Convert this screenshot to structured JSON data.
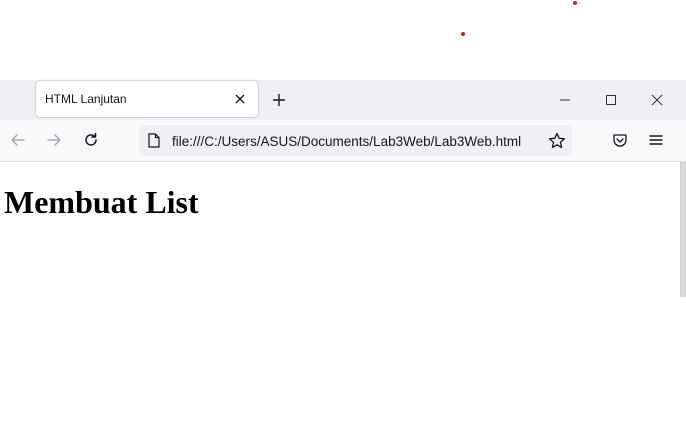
{
  "browser": {
    "tab": {
      "title": "HTML Lanjutan"
    },
    "address_bar": {
      "url": "file:///C:/Users/ASUS/Documents/Lab3Web/Lab3Web.html"
    }
  },
  "page": {
    "heading": "Membuat List"
  },
  "icons": {
    "tab_close": "close-icon",
    "new_tab": "plus-icon",
    "minimize": "minimize-icon",
    "maximize": "maximize-icon",
    "close_window": "close-icon",
    "back": "arrow-left-icon",
    "forward": "arrow-right-icon",
    "reload": "reload-icon",
    "page": "page-icon",
    "bookmark": "star-icon",
    "pocket": "pocket-icon",
    "menu": "hamburger-icon"
  },
  "colors": {
    "tab_strip": "#f0f0f4",
    "toolbar": "#f9f9fb",
    "url_field": "#f0f0f4",
    "marker_dots": "#d21f1f"
  }
}
